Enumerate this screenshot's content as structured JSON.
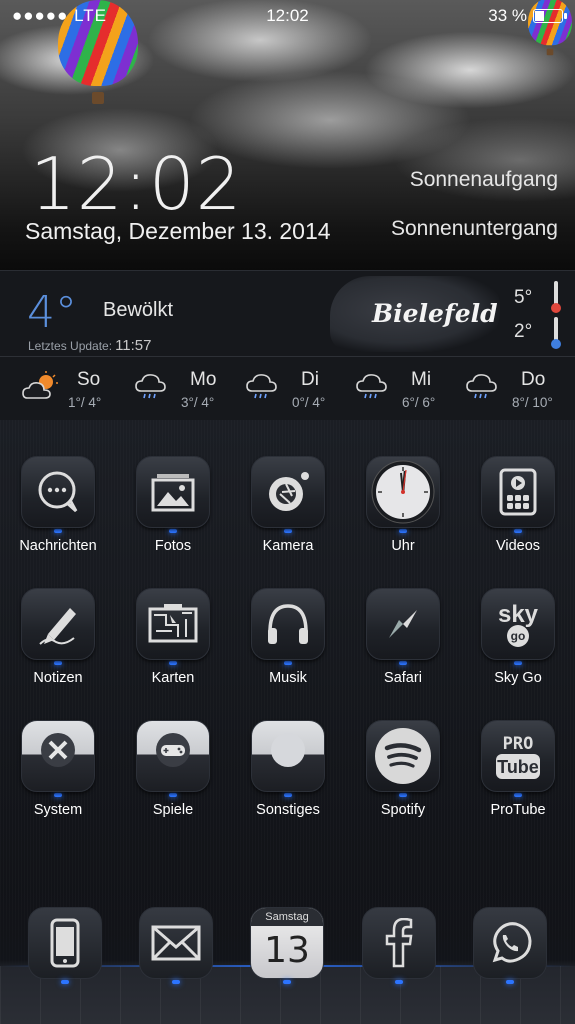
{
  "status_bar": {
    "signal": "●●●●● LTE",
    "time": "12:02",
    "battery": "33 %"
  },
  "clock": {
    "time": "12:02",
    "date": "Samstag, Dezember 13. 2014",
    "sunrise_label": "Sonnenaufgang",
    "sunset_label": "Sonnenuntergang"
  },
  "weather": {
    "current_temp": "4°",
    "condition": "Bewölkt",
    "updated_label": "Letztes Update:",
    "updated_time": "11:57",
    "city": "Bielefeld",
    "high": "5°",
    "low": "2°",
    "forecast": [
      {
        "day": "So",
        "range": "1°/ 4°",
        "icon": "partly-cloudy-icon"
      },
      {
        "day": "Mo",
        "range": "3°/ 4°",
        "icon": "rain-cloud-icon"
      },
      {
        "day": "Di",
        "range": "0°/ 4°",
        "icon": "rain-cloud-icon"
      },
      {
        "day": "Mi",
        "range": "6°/ 6°",
        "icon": "rain-cloud-icon"
      },
      {
        "day": "Do",
        "range": "8°/ 10°",
        "icon": "rain-cloud-icon"
      }
    ]
  },
  "apps": [
    {
      "label": "Nachrichten",
      "icon": "chat-bubble-icon"
    },
    {
      "label": "Fotos",
      "icon": "photos-icon"
    },
    {
      "label": "Kamera",
      "icon": "camera-aperture-icon"
    },
    {
      "label": "Uhr",
      "icon": "clock-icon"
    },
    {
      "label": "Videos",
      "icon": "video-player-icon"
    },
    {
      "label": "Notizen",
      "icon": "pen-icon"
    },
    {
      "label": "Karten",
      "icon": "map-icon"
    },
    {
      "label": "Musik",
      "icon": "headphones-icon"
    },
    {
      "label": "Safari",
      "icon": "compass-icon"
    },
    {
      "label": "Sky Go",
      "icon": "sky-go-logo-icon"
    },
    {
      "label": "System",
      "icon": "tools-icon"
    },
    {
      "label": "Spiele",
      "icon": "gamepad-icon"
    },
    {
      "label": "Sonstiges",
      "icon": "folder-icon"
    },
    {
      "label": "Spotify",
      "icon": "spotify-icon"
    },
    {
      "label": "ProTube",
      "icon": "protube-icon"
    }
  ],
  "icon_text": {
    "sky": "sky",
    "go": "go",
    "pro": "PRO",
    "tube": "Tube"
  },
  "dock": {
    "phone": "phone-icon",
    "mail": "mail-icon",
    "calendar_weekday": "Samstag",
    "calendar_day": "13",
    "facebook": "facebook-icon",
    "whatsapp": "whatsapp-icon"
  },
  "colors": {
    "accent": "#2c74ff",
    "temp_blue": "#5b8fdc",
    "thermo_hot": "#e0473c",
    "thermo_cold": "#3f7fe0"
  }
}
